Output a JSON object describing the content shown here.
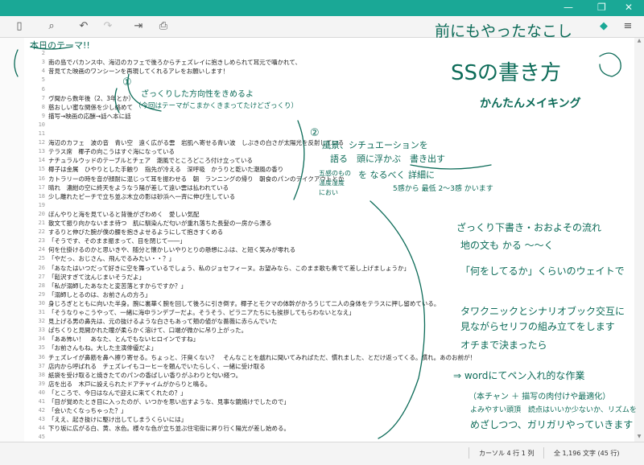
{
  "toolbar": {
    "icons": [
      "sidebar-toggle-icon",
      "search-icon",
      "undo-icon",
      "redo-icon",
      "export-icon",
      "print-icon",
      "theme-icon",
      "menu-icon"
    ]
  },
  "editor": {
    "lines": [
      {
        "n": "1",
        "text": "本日のテーマ!!"
      },
      {
        "n": "2",
        "text": ""
      },
      {
        "n": "3",
        "text": "南の島でバカンス中、海辺のカフェで後ろからチェズレイに抱きしめられて耳元で囁かれて、"
      },
      {
        "n": "4",
        "text": "昔見てた映画のワンシーンを再現してくれるアレをお願いします！"
      },
      {
        "n": "5",
        "text": ""
      },
      {
        "n": "6",
        "text": ""
      },
      {
        "n": "7",
        "text": "ヴ聞から数年後（2、3年とか）"
      },
      {
        "n": "8",
        "text": "慈おしい蜜な関係を少し絡めて"
      },
      {
        "n": "9",
        "text": "描写→映画の応酬→話へ本に話"
      },
      {
        "n": "10",
        "text": ""
      },
      {
        "n": "11",
        "text": ""
      },
      {
        "n": "12",
        "text": "海辺のカフェ　波の音　青い空　遠く広がる雲　岩肌へ寄せる青い波　しぶきの白さが太陽光を反射している"
      },
      {
        "n": "13",
        "text": "テラス席　椰子の向こうはすぐ海になっている"
      },
      {
        "n": "14",
        "text": "ナチュラルウッドのテーブルとチェア　潮風でところどころ付け立っている"
      },
      {
        "n": "15",
        "text": "椰子は金属　ひやりとした手触り　指先が冷える　深呼吸　かうりと乾いた潮風の香り"
      },
      {
        "n": "16",
        "text": "カトラリーの時を音が顔耐に混じって耳を振わせる　朝　ランニングの帰り　朝食のパンのテイクアウトとか"
      },
      {
        "n": "17",
        "text": "晴れ　濃紺の空に終天をようなう陽が差して遠い雲は払われている"
      },
      {
        "n": "18",
        "text": "少し離れたピーチで立ち並ぶ木立の影は砂浜へ一斉に伸び生している"
      },
      {
        "n": "19",
        "text": ""
      },
      {
        "n": "20",
        "text": "ぼんやりと海を見ていると背後がざわめく　愛しい気配"
      },
      {
        "n": "21",
        "text": "散文て振り向かないまま待つ　肌に馴染んだ匂いが重れ落ちた長髪の一房から漂る"
      },
      {
        "n": "22",
        "text": "するりと伸びた腕が僕の腰を抱きよせるようにして抱きすくめる"
      },
      {
        "n": "23",
        "text": "「そうです、そのまま振まって、目を閉じて――」"
      },
      {
        "n": "24",
        "text": "何を仕掛けるのかと思いきや、随分と懐かしいやりとりの懸想にふは、と短く笑みが零れる"
      },
      {
        "n": "25",
        "text": "「やだっ、おじさん、飛んでるみたい・・？」"
      },
      {
        "n": "26",
        "text": "「あなたはいつだって好きに空を舞っているでしょう、私のジョセフィーヌ。お望みなら、このまま歌も奏でて差し上げましょうか」"
      },
      {
        "n": "27",
        "text": "「鬆沢すぎて沈んじまいそうだよ」"
      },
      {
        "n": "28",
        "text": "「私が溺師したあなたと変苦落とすからですか？」"
      },
      {
        "n": "29",
        "text": "「溺師しとるのは、お前さんの方ろ」"
      },
      {
        "n": "30",
        "text": "身じろぎとともに向いた半身。腕に裏華く腕を回して後ろに引き倒す。椰子とモクマの体幹がかろうじて二人の身体をテラスに押し留めている。"
      },
      {
        "n": "31",
        "text": "「そうなりゃこうやって、一緒に海中ランデブーだよ。そうそう、ピラニアたちにも挨拶してもらわないとなえ」"
      },
      {
        "n": "32",
        "text": "見上げる男の鼻先は、元の抜けるような白さもあって頬の値がな薔薇に赤らんでいた"
      },
      {
        "n": "33",
        "text": "ぱちくりと見開かれた瞳が柔らかく溶けて、口端が微かに吊り上がった。"
      },
      {
        "n": "34",
        "text": "「ああ怖い！　あなた、とんでもないヒロインですね」"
      },
      {
        "n": "35",
        "text": "「お前さんもね。大した主演俳優だよ」"
      },
      {
        "n": "36",
        "text": "チェズレイが鼻筋を鼻へ擦り寄せる。ちょっと、汗臭くない？　そんなことを戯れに聞いてみればただ、慣れました、とだけ返ってくる。慣れ。あのお前が！"
      },
      {
        "n": "37",
        "text": "店内から呼ばれる　チェズレイもコーヒーを頼んでいたらしく、一緒に受け取る"
      },
      {
        "n": "38",
        "text": "紙袋を受け取ると焼きたてのパンの香ばしい香りがふわりと匂い経つ。"
      },
      {
        "n": "39",
        "text": "店を出る　木戸に設えられたドアチャイムがからりと鳴る。"
      },
      {
        "n": "40",
        "text": "「ところで、今日はなんで迎えに来てくれたの？」"
      },
      {
        "n": "41",
        "text": "「目が覚めたとき目に入ったのが、いつかを思い出すような、見事な鏡焼けでしたので」"
      },
      {
        "n": "42",
        "text": "「会いたくなっちゃった？」"
      },
      {
        "n": "43",
        "text": "「ええ、起き抜けに駆け出してしまうくらいには」"
      },
      {
        "n": "44",
        "text": "下り坂に広がる白、黄、水色。様々な色が立ち並ぶ住宅街に昇り行く陽光が差し始める。"
      },
      {
        "n": "45",
        "text": ""
      }
    ]
  },
  "annotations": {
    "title": [
      "前にもやったなこし",
      "SSの書き方",
      "かんたんメイキング"
    ],
    "step1_label": "①",
    "step1_lines": [
      "ざっくりした方向性をきめるよ",
      "（今回はテーマがこまかくきまってたけどざっくり）"
    ],
    "step2_label": "②",
    "step2_lines": [
      "風景、シチュエーションを",
      "語る　頭に浮かぶ　書き出す",
      "を なるべく 詳細に",
      "5感から 最低 2〜3感 かいます"
    ],
    "senses_note": [
      "五感のもの",
      "温度湿度",
      "におい"
    ],
    "main_lines": [
      "ざっくり下書き・おおよその流れ",
      "地の文も かる 〜〜く",
      "「何をしてるか」くらいのウェイトで",
      "タワクニックとシナリオブック交互に",
      "見ながらセリフの組み立てをします",
      "オチまで決まったら"
    ],
    "step3_lines": [
      "⇒ wordにてペン入れ的な作業",
      "（本チャン ＋ 描写の肉付けや最適化）",
      "よみやすい頭頂　読点はいいか少ないか、リズムを",
      "めざしつつ、ガリガリやっていきます"
    ]
  },
  "status": {
    "cursor": "カーソル 4 行 1 列",
    "count": "全 1,196 文字 (45 行)"
  },
  "colors": {
    "titlebar": "#1aa896",
    "ink": "#0c6b58"
  }
}
